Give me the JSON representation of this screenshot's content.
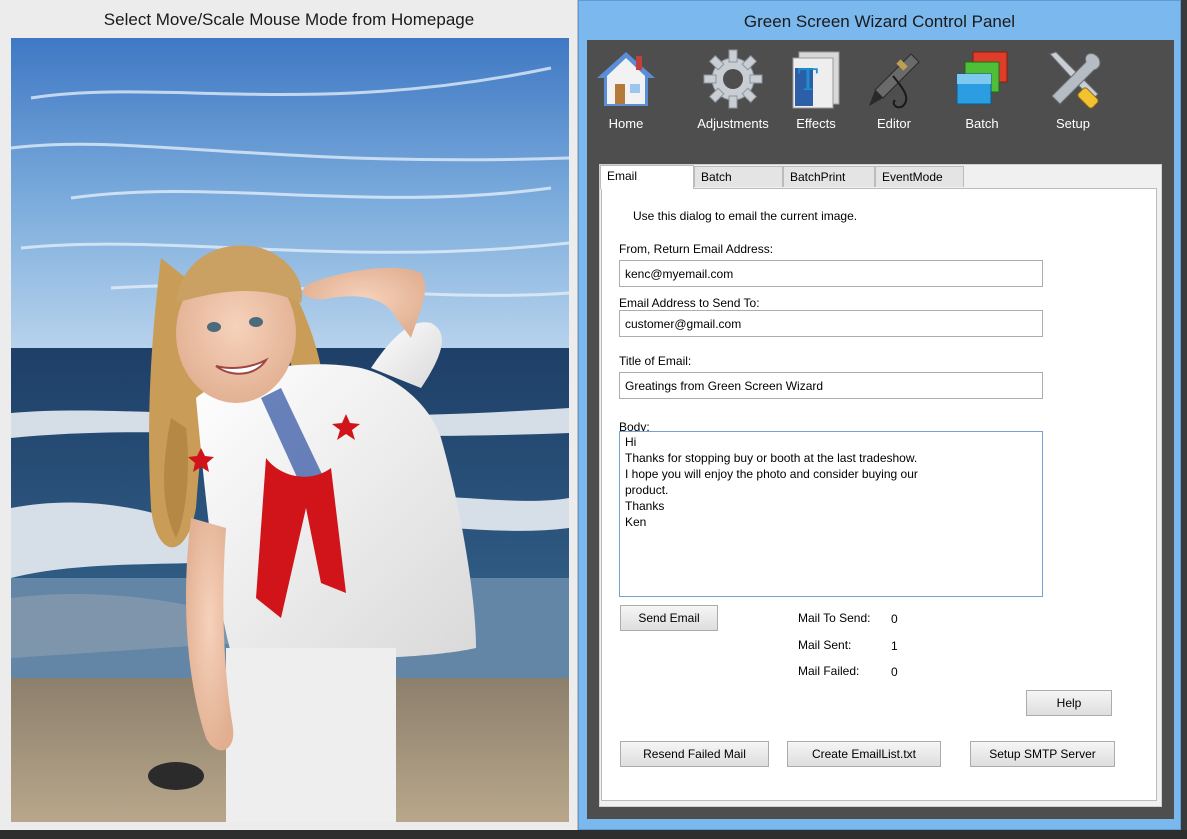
{
  "left": {
    "title": "Select Move/Scale Mouse Mode from Homepage"
  },
  "panel": {
    "title": "Green Screen Wizard Control Panel"
  },
  "toolbar": {
    "items": [
      {
        "label": "Home",
        "icon": "house-icon"
      },
      {
        "label": "Adjustments",
        "icon": "gear-icon"
      },
      {
        "label": "Effects",
        "icon": "effects-icon"
      },
      {
        "label": "Editor",
        "icon": "airbrush-icon"
      },
      {
        "label": "Batch",
        "icon": "layers-icon"
      },
      {
        "label": "Setup",
        "icon": "tools-icon"
      }
    ]
  },
  "tabs": [
    "Email",
    "Batch",
    "BatchPrint",
    "EventMode"
  ],
  "email": {
    "intro": "Use this dialog to email the current image.",
    "from_label": "From, Return Email Address:",
    "from_value": "kenc@myemail.com",
    "to_label": "Email Address to Send To:",
    "to_value": "customer@gmail.com",
    "title_label": "Title of Email:",
    "title_value": "Greatings from Green Screen Wizard",
    "body_label": "Body:",
    "body_value": "Hi\nThanks for stopping buy or booth at the last tradeshow.\nI hope you will enjoy the photo and consider buying our\nproduct.\nThanks\nKen",
    "send_button": "Send Email",
    "stats": {
      "to_send_label": "Mail To Send:",
      "to_send_value": "0",
      "sent_label": "Mail Sent:",
      "sent_value": "1",
      "failed_label": "Mail Failed:",
      "failed_value": "0"
    },
    "help_button": "Help",
    "resend_button": "Resend Failed Mail",
    "create_list_button": "Create EmailList.txt",
    "smtp_button": "Setup SMTP Server"
  },
  "colors": {
    "panel_blue": "#7ab8ee",
    "panel_dark": "#4e4e4e",
    "textbox_focus_border": "#7a9fd1"
  }
}
